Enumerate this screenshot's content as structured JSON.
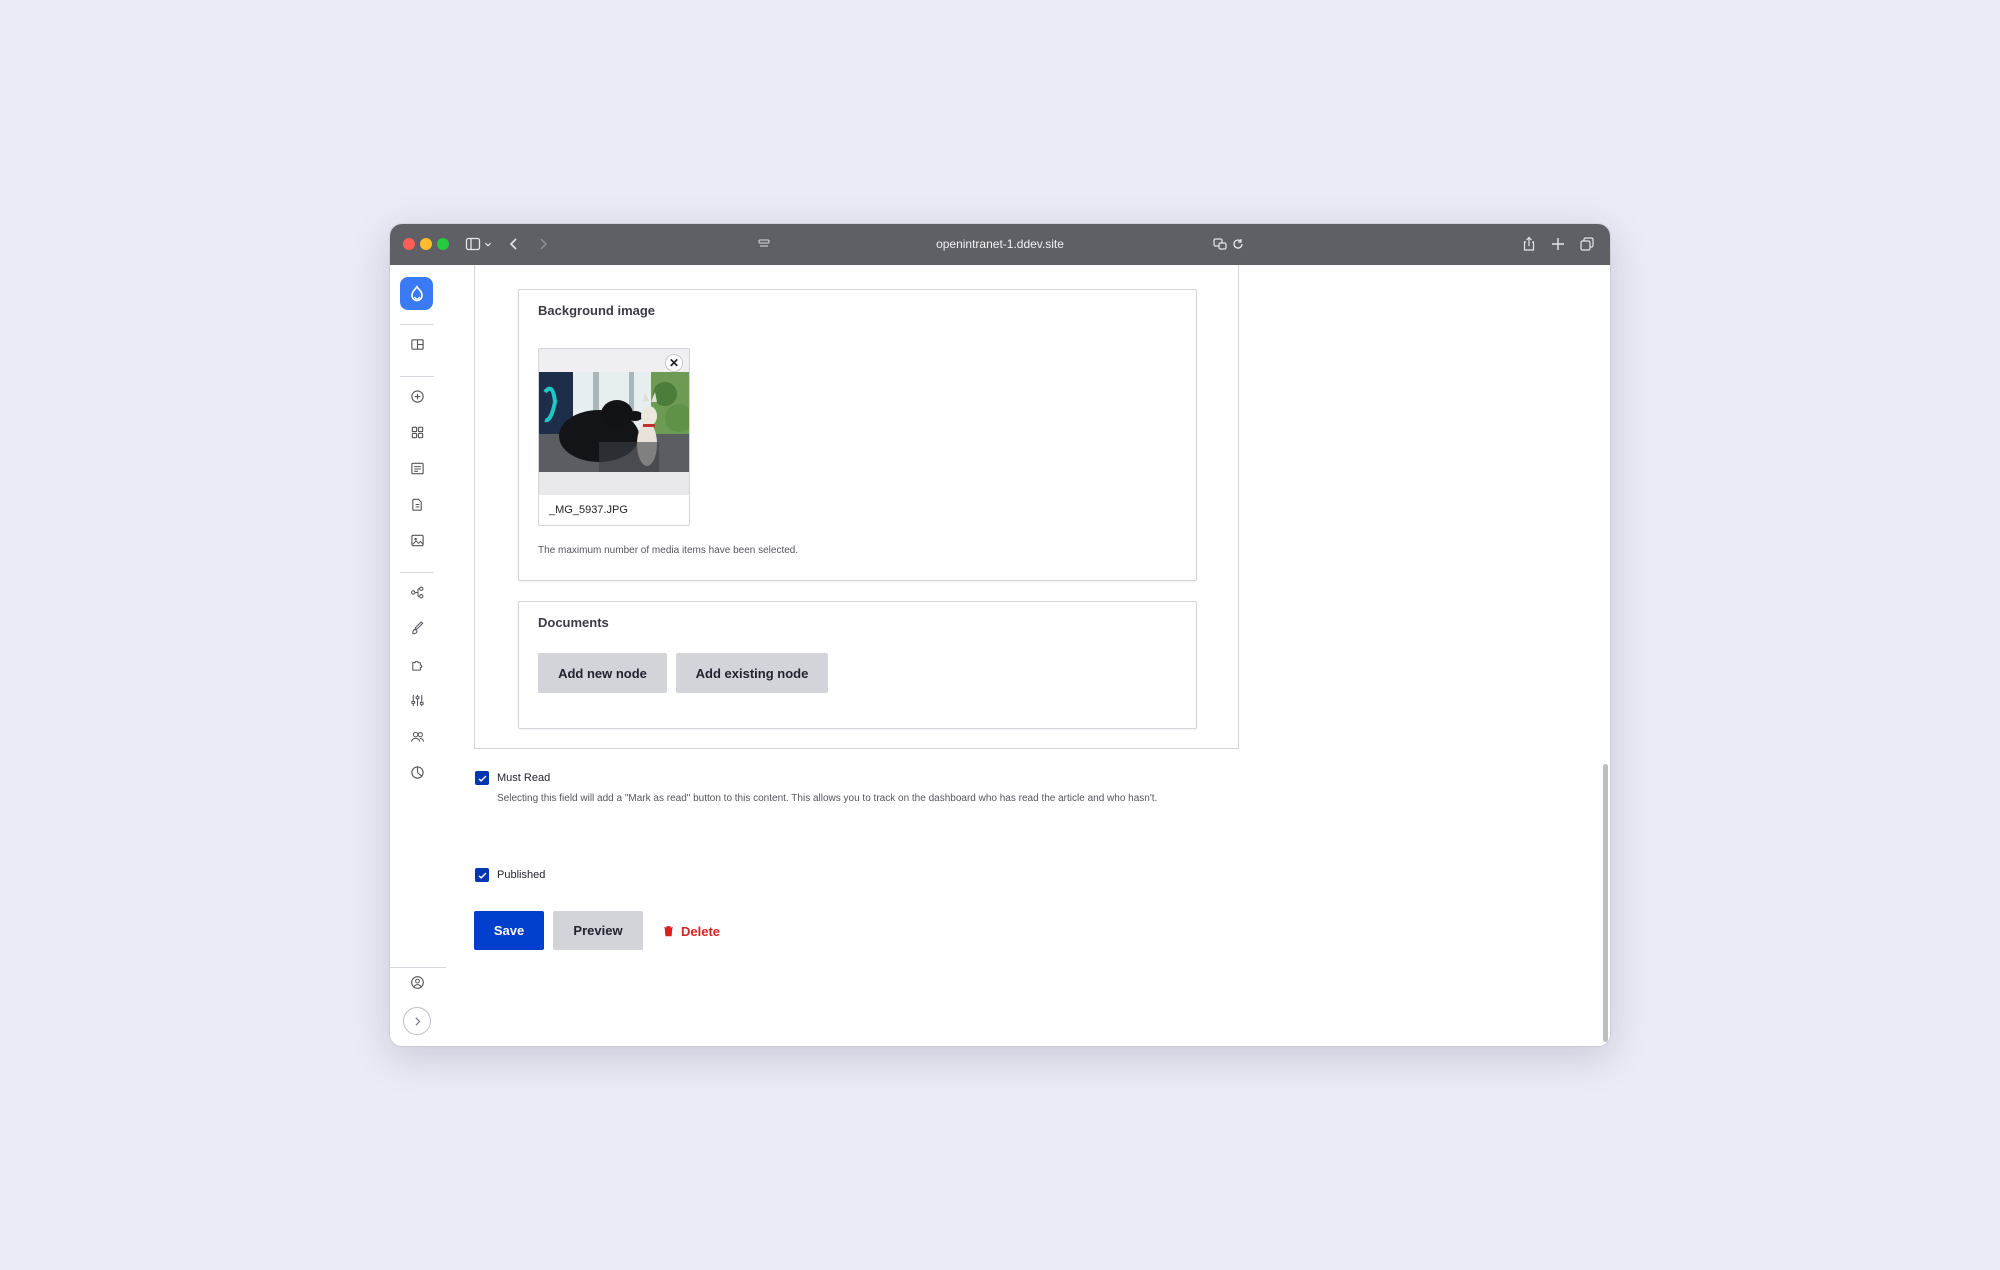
{
  "browser": {
    "url": "openintranet-1.ddev.site"
  },
  "sidebar": {
    "items": [
      {
        "icon": "layout-icon"
      },
      {
        "icon": "add-content-icon"
      },
      {
        "icon": "grid-icon"
      },
      {
        "icon": "content-list-icon"
      },
      {
        "icon": "documents-icon"
      },
      {
        "icon": "media-icon"
      },
      {
        "icon": "structure-icon"
      },
      {
        "icon": "appearance-icon"
      },
      {
        "icon": "extend-icon"
      },
      {
        "icon": "configuration-icon"
      },
      {
        "icon": "people-icon"
      },
      {
        "icon": "reports-icon"
      }
    ],
    "account_icon": "user-icon",
    "collapse_icon": "chevron-right-icon"
  },
  "background_image": {
    "legend": "Background image",
    "media_filename": "_MG_5937.JPG",
    "help_text": "The maximum number of media items have been selected."
  },
  "documents": {
    "legend": "Documents",
    "add_new_label": "Add new node",
    "add_existing_label": "Add existing node"
  },
  "must_read": {
    "label": "Must Read",
    "checked": true,
    "description": "Selecting this field will add a \"Mark as read\" button to this content. This allows you to track on the dashboard who has read the article and who hasn't."
  },
  "published": {
    "label": "Published",
    "checked": true
  },
  "actions": {
    "save_label": "Save",
    "preview_label": "Preview",
    "delete_label": "Delete"
  },
  "colors": {
    "primary": "#003ecc",
    "danger": "#d72222",
    "drupal_blue": "#3a7bf5"
  }
}
